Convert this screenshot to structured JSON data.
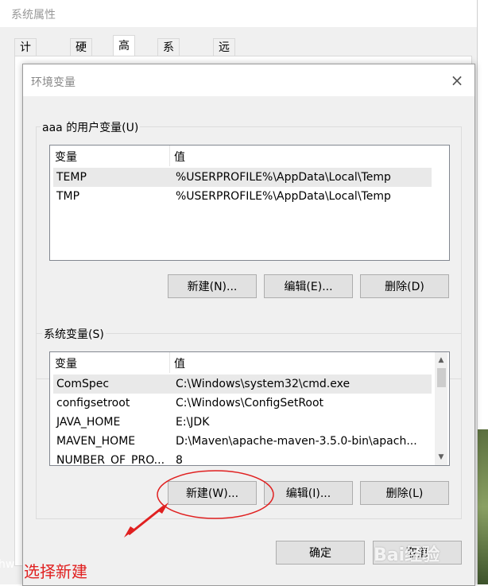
{
  "outer_window": {
    "title": "系统属性",
    "tabs": [
      "计算机名",
      "硬件",
      "高级",
      "系统保护",
      "远程"
    ],
    "active_tab": "高级"
  },
  "dialog": {
    "title": "环境变量",
    "close_glyph": "×",
    "user_group": {
      "label": "aaa 的用户变量(U)",
      "columns": [
        "变量",
        "值"
      ],
      "rows": [
        {
          "var": "TEMP",
          "val": "%USERPROFILE%\\AppData\\Local\\Temp",
          "selected": true
        },
        {
          "var": "TMP",
          "val": "%USERPROFILE%\\AppData\\Local\\Temp",
          "selected": false
        }
      ],
      "buttons": {
        "new": "新建(N)...",
        "edit": "编辑(E)...",
        "delete": "删除(D)"
      }
    },
    "system_group": {
      "label": "系统变量(S)",
      "columns": [
        "变量",
        "值"
      ],
      "rows": [
        {
          "var": "ComSpec",
          "val": "C:\\Windows\\system32\\cmd.exe",
          "selected": true
        },
        {
          "var": "configsetroot",
          "val": "C:\\Windows\\ConfigSetRoot",
          "selected": false
        },
        {
          "var": "JAVA_HOME",
          "val": "E:\\JDK",
          "selected": false
        },
        {
          "var": "MAVEN_HOME",
          "val": "D:\\Maven\\apache-maven-3.5.0-bin\\apach...",
          "selected": false
        },
        {
          "var": "NUMBER_OF_PRO...",
          "val": "8",
          "selected": false
        }
      ],
      "buttons": {
        "new": "新建(W)...",
        "edit": "编辑(I)...",
        "delete": "删除(L)"
      }
    },
    "footer": {
      "ok": "确定",
      "cancel": "取消"
    }
  },
  "annotation": {
    "text": "选择新建",
    "color": "#e02020"
  },
  "watermark": "Bai经验",
  "desktop_label": "hw",
  "colors": {
    "dialog_bg": "#f0f0f0",
    "button_bg": "#e1e1e1",
    "annotation_red": "#e02020"
  }
}
